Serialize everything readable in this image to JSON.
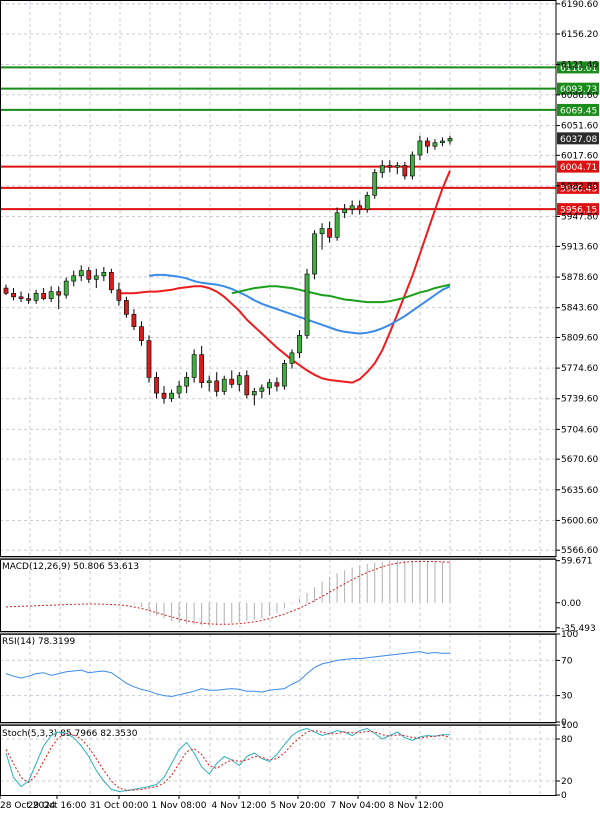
{
  "chart_data": {
    "type": "candlestick",
    "main": {
      "ylim": [
        5560,
        6195
      ],
      "y_ticks": [
        "6190.60",
        "6156.20",
        "6121.40",
        "6086.60",
        "6051.60",
        "6017.60",
        "5982.80",
        "5947.80",
        "5913.60",
        "5878.60",
        "5843.60",
        "5809.60",
        "5774.60",
        "5739.60",
        "5704.60",
        "5670.60",
        "5635.60",
        "5600.60",
        "5566.60"
      ],
      "candles": [
        [
          5866,
          5870,
          5858,
          5860
        ],
        [
          5860,
          5866,
          5852,
          5856
        ],
        [
          5856,
          5862,
          5850,
          5854
        ],
        [
          5854,
          5860,
          5848,
          5852
        ],
        [
          5852,
          5864,
          5848,
          5860
        ],
        [
          5860,
          5866,
          5852,
          5854
        ],
        [
          5854,
          5868,
          5850,
          5862
        ],
        [
          5862,
          5868,
          5842,
          5858
        ],
        [
          5858,
          5878,
          5854,
          5874
        ],
        [
          5874,
          5886,
          5868,
          5880
        ],
        [
          5880,
          5892,
          5874,
          5886
        ],
        [
          5886,
          5890,
          5872,
          5876
        ],
        [
          5876,
          5888,
          5866,
          5880
        ],
        [
          5880,
          5890,
          5874,
          5884
        ],
        [
          5884,
          5888,
          5860,
          5864
        ],
        [
          5864,
          5872,
          5846,
          5852
        ],
        [
          5852,
          5856,
          5832,
          5836
        ],
        [
          5836,
          5842,
          5818,
          5822
        ],
        [
          5822,
          5828,
          5800,
          5806
        ],
        [
          5806,
          5812,
          5758,
          5764
        ],
        [
          5764,
          5770,
          5740,
          5746
        ],
        [
          5746,
          5754,
          5734,
          5740
        ],
        [
          5740,
          5750,
          5736,
          5746
        ],
        [
          5746,
          5760,
          5740,
          5754
        ],
        [
          5754,
          5770,
          5746,
          5764
        ],
        [
          5764,
          5796,
          5758,
          5790
        ],
        [
          5790,
          5800,
          5752,
          5758
        ],
        [
          5758,
          5766,
          5748,
          5760
        ],
        [
          5760,
          5770,
          5742,
          5748
        ],
        [
          5748,
          5766,
          5744,
          5762
        ],
        [
          5762,
          5772,
          5752,
          5756
        ],
        [
          5756,
          5770,
          5748,
          5766
        ],
        [
          5766,
          5772,
          5740,
          5744
        ],
        [
          5744,
          5752,
          5732,
          5748
        ],
        [
          5748,
          5756,
          5740,
          5752
        ],
        [
          5752,
          5762,
          5744,
          5758
        ],
        [
          5758,
          5764,
          5748,
          5754
        ],
        [
          5754,
          5784,
          5750,
          5780
        ],
        [
          5780,
          5796,
          5774,
          5792
        ],
        [
          5792,
          5818,
          5786,
          5812
        ],
        [
          5812,
          5888,
          5808,
          5882
        ],
        [
          5882,
          5932,
          5876,
          5928
        ],
        [
          5928,
          5940,
          5910,
          5934
        ],
        [
          5934,
          5942,
          5918,
          5924
        ],
        [
          5924,
          5958,
          5920,
          5952
        ],
        [
          5952,
          5962,
          5946,
          5956
        ],
        [
          5956,
          5966,
          5950,
          5960
        ],
        [
          5960,
          5966,
          5950,
          5956
        ],
        [
          5956,
          5976,
          5952,
          5972
        ],
        [
          5972,
          6002,
          5968,
          5998
        ],
        [
          5998,
          6012,
          5992,
          6006
        ],
        [
          6006,
          6012,
          5998,
          6004
        ],
        [
          6004,
          6010,
          5996,
          6006
        ],
        [
          6006,
          6010,
          5990,
          5994
        ],
        [
          5994,
          6022,
          5990,
          6018
        ],
        [
          6018,
          6040,
          6012,
          6034
        ],
        [
          6034,
          6038,
          6020,
          6028
        ],
        [
          6028,
          6036,
          6024,
          6032
        ],
        [
          6032,
          6038,
          6028,
          6034
        ],
        [
          6034,
          6040,
          6030,
          6037
        ]
      ],
      "series": [
        {
          "name": "MA red",
          "color": "#ee1c1c",
          "values": [
            5860,
            5860,
            5860,
            5861,
            5862,
            5862,
            5863,
            5864,
            5866,
            5867,
            5868,
            5868,
            5866,
            5862,
            5856,
            5848,
            5840,
            5830,
            5822,
            5814,
            5806,
            5798,
            5791,
            5784,
            5778,
            5772,
            5767,
            5763,
            5761,
            5760,
            5759,
            5758,
            5762,
            5770,
            5780,
            5795,
            5815,
            5836,
            5858,
            5880,
            5905,
            5930,
            5955,
            5980,
            6000
          ]
        },
        {
          "name": "MA blue",
          "color": "#3a8be8",
          "values": [
            5880,
            5881,
            5881,
            5880,
            5879,
            5877,
            5874,
            5872,
            5871,
            5870,
            5868,
            5865,
            5861,
            5857,
            5852,
            5848,
            5845,
            5842,
            5839,
            5836,
            5833,
            5830,
            5827,
            5824,
            5821,
            5818,
            5816,
            5815,
            5814,
            5815,
            5817,
            5820,
            5824,
            5829,
            5834,
            5840,
            5846,
            5852,
            5858,
            5864,
            5868
          ]
        },
        {
          "name": "MA green",
          "color": "#199f19",
          "values": [
            5860,
            5862,
            5864,
            5866,
            5867,
            5868,
            5868,
            5867,
            5866,
            5864,
            5862,
            5860,
            5858,
            5857,
            5855,
            5853,
            5852,
            5851,
            5850,
            5850,
            5850,
            5851,
            5853,
            5855,
            5858,
            5861,
            5863,
            5866,
            5868,
            5870
          ]
        }
      ],
      "levels": [
        {
          "label": "6118.01",
          "value": 6118.01,
          "color": "#1a8c1a"
        },
        {
          "label": "6093.73",
          "value": 6093.73,
          "color": "#1a8c1a"
        },
        {
          "label": "6069.45",
          "value": 6069.45,
          "color": "#1a8c1a"
        },
        {
          "label": "6004.71",
          "value": 6004.71,
          "color": "#dd1111"
        },
        {
          "label": "5980.43",
          "value": 5980.43,
          "color": "#dd1111"
        },
        {
          "label": "5956.15",
          "value": 5956.15,
          "color": "#dd1111"
        }
      ],
      "current_price": "6037.08",
      "current_color": "#2b2b2b"
    },
    "macd": {
      "label": "MACD(12,26,9) 50.806 53.613",
      "ylim": [
        -40,
        62
      ],
      "y_ticks": [
        {
          "label": "59.671",
          "value": 59.671
        },
        {
          "label": "0.00",
          "value": 0
        },
        {
          "label": "-35.493",
          "value": -35.493
        }
      ],
      "histogram": [
        0,
        0,
        0,
        0,
        0,
        0,
        0,
        0,
        0,
        0,
        0,
        0,
        0,
        0,
        0,
        0,
        0,
        -2,
        -6,
        -12,
        -18,
        -22,
        -26,
        -28,
        -30,
        -31,
        -32,
        -32,
        -31,
        -30,
        -29,
        -28,
        -26,
        -24,
        -22,
        -18,
        -14,
        -8,
        -1,
        6,
        14,
        22,
        30,
        36,
        42,
        46,
        50,
        53,
        55,
        57,
        58,
        59,
        59.5,
        59.6,
        59.7,
        59.5,
        59.2,
        58.8,
        58.4,
        58.0
      ],
      "signal": [
        -6,
        -5.5,
        -5,
        -4.6,
        -4.2,
        -3.8,
        -3.4,
        -3,
        -2.6,
        -2.2,
        -2,
        -1.8,
        -1.8,
        -2,
        -2.4,
        -3,
        -4,
        -6,
        -8,
        -11,
        -14,
        -17,
        -20,
        -23,
        -25.5,
        -27.5,
        -29,
        -30,
        -30.5,
        -30.5,
        -30.2,
        -29.5,
        -28.5,
        -27,
        -25,
        -22.5,
        -19.5,
        -16,
        -12,
        -7.5,
        -2.5,
        3,
        9,
        15,
        21,
        27,
        33,
        38,
        43,
        47,
        51,
        54,
        56,
        57.5,
        58.3,
        58.6,
        58.6,
        58.3,
        57.9,
        57.5
      ]
    },
    "rsi": {
      "label": "RSI(14) 78.3199",
      "ylim": [
        0,
        100
      ],
      "y_ticks": [
        {
          "label": "100",
          "value": 100
        },
        {
          "label": "70",
          "value": 70
        },
        {
          "label": "30",
          "value": 30
        },
        {
          "label": "0",
          "value": 0
        }
      ],
      "values": [
        55,
        52,
        50,
        52,
        55,
        56,
        53,
        55,
        57,
        58,
        59,
        56,
        57,
        58,
        56,
        50,
        44,
        40,
        37,
        35,
        32,
        30,
        29,
        31,
        33,
        35,
        38,
        36,
        36,
        37,
        38,
        37,
        35,
        35,
        34,
        36,
        37,
        38,
        43,
        47,
        55,
        62,
        66,
        68,
        70,
        71,
        72,
        72,
        73,
        74,
        75,
        76,
        77,
        78,
        79,
        80,
        78,
        79,
        78,
        78.3
      ]
    },
    "stoch": {
      "label": "Stoch(5,3,3) 85.7966 82.3530",
      "ylim": [
        0,
        100
      ],
      "y_ticks": [
        {
          "label": "100",
          "value": 100
        },
        {
          "label": "80",
          "value": 80
        },
        {
          "label": "20",
          "value": 20
        },
        {
          "label": "0",
          "value": 0
        }
      ],
      "k": [
        60,
        25,
        12,
        20,
        45,
        70,
        85,
        90,
        88,
        82,
        70,
        55,
        35,
        20,
        8,
        5,
        6,
        8,
        10,
        12,
        15,
        25,
        45,
        65,
        75,
        60,
        40,
        30,
        45,
        55,
        50,
        42,
        55,
        60,
        52,
        48,
        58,
        72,
        85,
        92,
        95,
        90,
        85,
        88,
        92,
        90,
        85,
        92,
        95,
        88,
        80,
        85,
        90,
        82,
        78,
        83,
        85,
        84,
        86,
        86
      ],
      "d": [
        65,
        45,
        25,
        18,
        28,
        48,
        68,
        82,
        88,
        86,
        80,
        68,
        52,
        35,
        20,
        10,
        7,
        7,
        8,
        10,
        12,
        17,
        28,
        45,
        62,
        66,
        58,
        42,
        38,
        45,
        50,
        48,
        50,
        55,
        54,
        50,
        52,
        60,
        72,
        82,
        90,
        92,
        90,
        87,
        88,
        90,
        89,
        89,
        91,
        90,
        86,
        84,
        86,
        85,
        82,
        81,
        83,
        84,
        85,
        82.4
      ]
    },
    "x_ticks": [
      "28 Oct 2024",
      "29 Oct 16:00",
      "31 Oct 00:00",
      "1 Nov 08:00",
      "4 Nov 12:00",
      "5 Nov 20:00",
      "7 Nov 04:00",
      "8 Nov 12:00"
    ]
  }
}
